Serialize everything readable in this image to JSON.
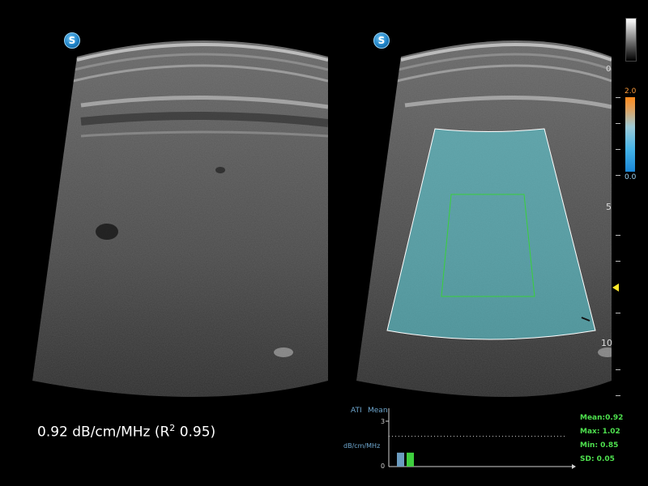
{
  "left_image": {
    "logo_letter": "S"
  },
  "right_image": {
    "logo_letter": "S"
  },
  "color_scale": {
    "max_label": "2.0",
    "min_label": "0.0",
    "top_color": "#ff8a1c",
    "bottom_color": "#1a86d6"
  },
  "gray_scale": {
    "label": "0"
  },
  "depth_scale": {
    "labels": [
      {
        "value": "0"
      },
      {
        "value": "5"
      },
      {
        "value": "10"
      }
    ],
    "focus_marker_color": "#ffe82a"
  },
  "measurement": {
    "value_text": "0.92 dB/cm/MHz (R",
    "superscript": "2",
    "r_squared_text": " 0.95)"
  },
  "ati_chart": {
    "title_left": "ATI",
    "title_right": "Mean",
    "ylabel": "dB/cm/MHz",
    "y_ticks": [
      "3",
      "0"
    ],
    "series_colors": [
      "#6b9cc0",
      "#3ecf3e"
    ]
  },
  "chart_data": {
    "type": "bar",
    "title": "ATI",
    "xlabel": "",
    "ylabel": "dB/cm/MHz",
    "ylim": [
      0,
      3
    ],
    "reference_line": 2,
    "series": [
      {
        "name": "ATI",
        "values": [
          0.92
        ]
      },
      {
        "name": "Mean",
        "values": [
          0.92
        ]
      }
    ]
  },
  "stats": {
    "mean": "Mean:0.92",
    "max": "Max: 1.02",
    "min": "Min: 0.85",
    "sd": "SD:  0.05"
  },
  "overlay": {
    "roi_color": "#5fd2dc",
    "box_color": "#39d039"
  }
}
